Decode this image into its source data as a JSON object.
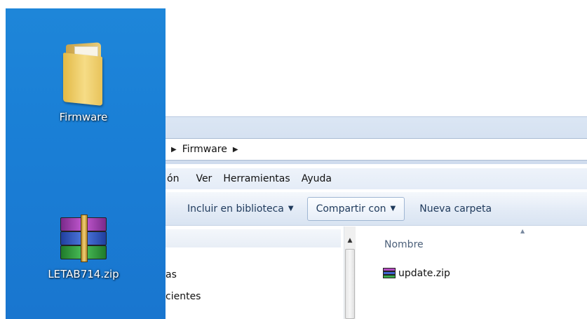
{
  "desktop": {
    "icons": [
      {
        "label": "Firmware",
        "icon": "folder-icon"
      },
      {
        "label": "LETAB714.zip",
        "icon": "winrar-archive-icon"
      }
    ]
  },
  "explorer": {
    "breadcrumb": {
      "segment": "Firmware"
    },
    "menu": [
      "ón",
      "Ver",
      "Herramientas",
      "Ayuda"
    ],
    "toolbar": {
      "include_library": "Incluir en biblioteca",
      "share_with": "Compartir con",
      "new_folder": "Nueva carpeta"
    },
    "nav_items": [
      "as",
      "cientes"
    ],
    "columns": {
      "name": "Nombre"
    },
    "files": [
      {
        "name": "update.zip",
        "icon": "winrar-archive-icon"
      }
    ]
  },
  "colors": {
    "desktop_blue": "#1a7fd6",
    "toolbar_text": "#1e395b"
  }
}
